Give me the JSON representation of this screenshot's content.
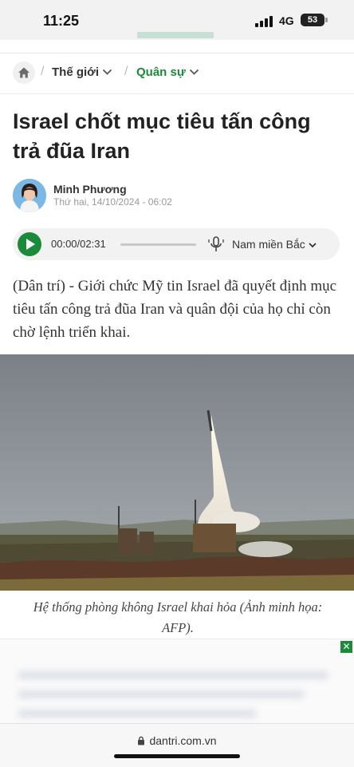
{
  "status_bar": {
    "time": "11:25",
    "network": "4G",
    "battery": "53"
  },
  "breadcrumb": {
    "section": "Thế giới",
    "subsection": "Quân sự"
  },
  "article": {
    "title": "Israel chốt mục tiêu tấn công trả đũa Iran",
    "author": "Minh Phương",
    "date": "Thứ hai, 14/10/2024 - 06:02",
    "lead": "(Dân trí) - Giới chức Mỹ tin Israel đã quyết định mục tiêu tấn công trả đũa Iran và quân đội của họ chỉ còn chờ lệnh triển khai.",
    "caption": "Hệ thống phòng không Israel khai hỏa (Ảnh minh họa: AFP)."
  },
  "audio": {
    "time": "00:00/02:31",
    "voice": "Nam miền Bắc",
    "progress": 0
  },
  "browser": {
    "url": "dantri.com.vn"
  },
  "colors": {
    "accent": "#1b8a3a",
    "text": "#222222",
    "muted": "#999999"
  },
  "icons": {
    "home": "home-icon",
    "chevron": "chevron-down-icon",
    "play": "play-icon",
    "mic": "microphone-icon",
    "close": "close-icon",
    "lock": "lock-icon"
  }
}
